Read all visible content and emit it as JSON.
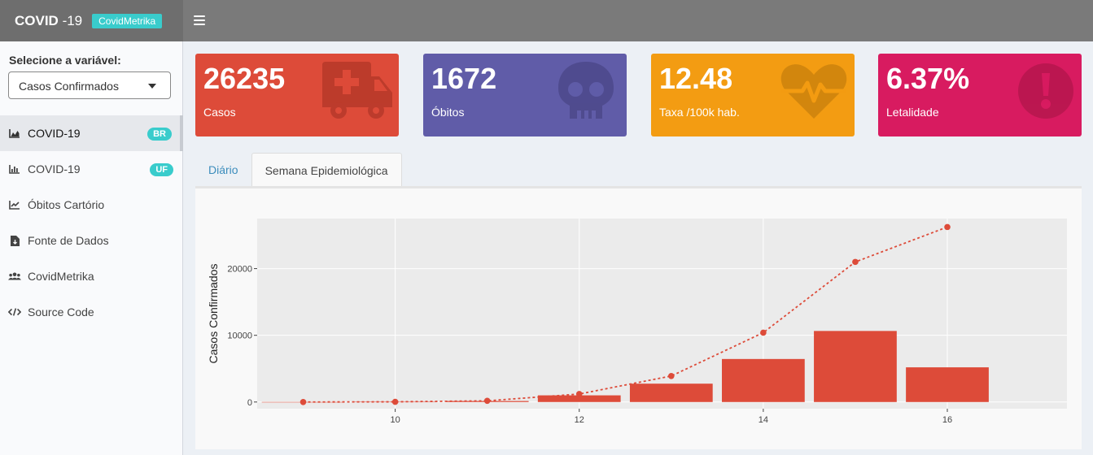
{
  "header": {
    "title": "COVID",
    "title_suffix": " -19",
    "badge": "CovidMetrika"
  },
  "sidebar": {
    "select_label": "Selecione a variável:",
    "select_value": "Casos Confirmados",
    "items": [
      {
        "label": "COVID-19",
        "icon": "area-chart-icon",
        "badge": "BR",
        "active": true
      },
      {
        "label": "COVID-19",
        "icon": "bar-chart-icon",
        "badge": "UF",
        "active": false
      },
      {
        "label": "Óbitos Cartório",
        "icon": "line-chart-icon",
        "badge": "",
        "active": false
      },
      {
        "label": "Fonte de Dados",
        "icon": "file-download-icon",
        "badge": "",
        "active": false
      },
      {
        "label": "CovidMetrika",
        "icon": "users-icon",
        "badge": "",
        "active": false
      },
      {
        "label": "Source Code",
        "icon": "code-icon",
        "badge": "",
        "active": false
      }
    ]
  },
  "value_boxes": [
    {
      "value": "26235",
      "label": "Casos",
      "color": "#dd4b39",
      "icon": "ambulance-icon"
    },
    {
      "value": "1672",
      "label": "Óbitos",
      "color": "#605ca8",
      "icon": "skull-icon"
    },
    {
      "value": "12.48",
      "label": "Taxa /100k hab.",
      "color": "#f39c12",
      "icon": "heartbeat-icon"
    },
    {
      "value": "6.37%",
      "label": "Letalidade",
      "color": "#d81b60",
      "icon": "exclamation-circle-icon"
    }
  ],
  "tabs": [
    {
      "label": "Diário",
      "active": false
    },
    {
      "label": "Semana Epidemiológica",
      "active": true
    }
  ],
  "chart_data": {
    "type": "bar",
    "ylabel": "Casos Confirmados",
    "xlabel": "",
    "xlim": [
      8.5,
      17.3
    ],
    "ylim": [
      -1000,
      27500
    ],
    "xticks": [
      10,
      12,
      14,
      16
    ],
    "yticks": [
      0,
      10000,
      20000
    ],
    "grid": true,
    "series": [
      {
        "type": "bar",
        "x": [
          9,
          10,
          11,
          12,
          13,
          14,
          15,
          16
        ],
        "values": [
          2,
          30,
          150,
          1000,
          2750,
          6450,
          10650,
          5200
        ],
        "color": "#dd4b39"
      },
      {
        "type": "line",
        "x": [
          9,
          10,
          11,
          12,
          13,
          14,
          15,
          16
        ],
        "values": [
          2,
          32,
          180,
          1200,
          3900,
          10400,
          21000,
          26235
        ],
        "color": "#dd4b39",
        "dash": true
      }
    ]
  }
}
